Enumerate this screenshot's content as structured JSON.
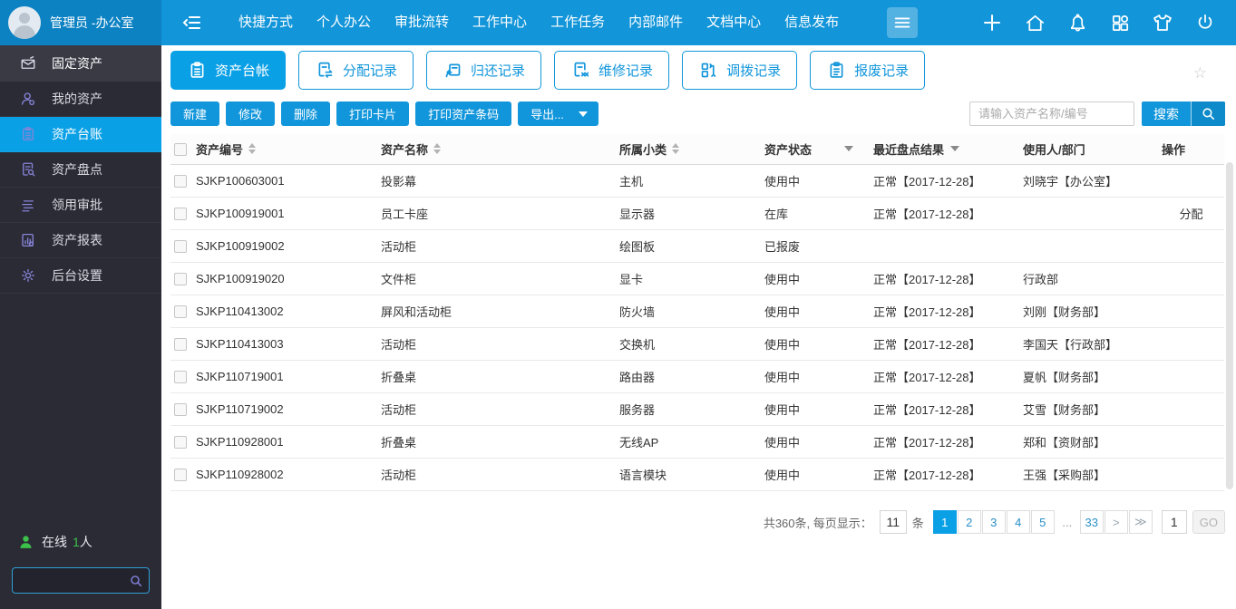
{
  "header": {
    "user_name": "管理员 -办公室",
    "nav": [
      "快捷方式",
      "个人办公",
      "审批流转",
      "工作中心",
      "工作任务",
      "内部邮件",
      "文档中心",
      "信息发布"
    ]
  },
  "sidebar": {
    "section_label": "固定资产",
    "items": [
      {
        "label": "我的资产"
      },
      {
        "label": "资产台账"
      },
      {
        "label": "资产盘点"
      },
      {
        "label": "领用审批"
      },
      {
        "label": "资产报表"
      },
      {
        "label": "后台设置"
      }
    ],
    "online_label": "在线",
    "online_count": "1",
    "online_unit": "人"
  },
  "tabs": [
    {
      "label": "资产台帐"
    },
    {
      "label": "分配记录"
    },
    {
      "label": "归还记录"
    },
    {
      "label": "维修记录"
    },
    {
      "label": "调拨记录"
    },
    {
      "label": "报废记录"
    }
  ],
  "toolbar": {
    "new": "新建",
    "edit": "修改",
    "delete": "删除",
    "print_card": "打印卡片",
    "print_barcode": "打印资产条码",
    "export": "导出...",
    "search_placeholder": "请输入资产名称/编号",
    "search_label": "搜索"
  },
  "table": {
    "columns": {
      "id": "资产编号",
      "name": "资产名称",
      "category": "所属小类",
      "status": "资产状态",
      "result": "最近盘点结果",
      "user": "使用人/部门",
      "op": "操作"
    },
    "rows": [
      {
        "id": "SJKP100603001",
        "name": "投影幕",
        "category": "主机",
        "status": "使用中",
        "result": "正常【2017-12-28】",
        "user": "刘晓宇【办公室】",
        "op": ""
      },
      {
        "id": "SJKP100919001",
        "name": "员工卡座",
        "category": "显示器",
        "status": "在库",
        "result": "正常【2017-12-28】",
        "user": "",
        "op": "分配"
      },
      {
        "id": "SJKP100919002",
        "name": "活动柜",
        "category": "绘图板",
        "status": "已报废",
        "result": "",
        "user": "",
        "op": ""
      },
      {
        "id": "SJKP100919020",
        "name": "文件柜",
        "category": "显卡",
        "status": "使用中",
        "result": "正常【2017-12-28】",
        "user": "行政部",
        "op": ""
      },
      {
        "id": "SJKP110413002",
        "name": "屏风和活动柜",
        "category": "防火墙",
        "status": "使用中",
        "result": "正常【2017-12-28】",
        "user": "刘刚【财务部】",
        "op": ""
      },
      {
        "id": "SJKP110413003",
        "name": "活动柜",
        "category": "交换机",
        "status": "使用中",
        "result": "正常【2017-12-28】",
        "user": "李国天【行政部】",
        "op": ""
      },
      {
        "id": "SJKP110719001",
        "name": "折叠桌",
        "category": "路由器",
        "status": "使用中",
        "result": "正常【2017-12-28】",
        "user": "夏帆【财务部】",
        "op": ""
      },
      {
        "id": "SJKP110719002",
        "name": "活动柜",
        "category": "服务器",
        "status": "使用中",
        "result": "正常【2017-12-28】",
        "user": "艾雪【财务部】",
        "op": ""
      },
      {
        "id": "SJKP110928001",
        "name": "折叠桌",
        "category": "无线AP",
        "status": "使用中",
        "result": "正常【2017-12-28】",
        "user": "郑和【资财部】",
        "op": ""
      },
      {
        "id": "SJKP110928002",
        "name": "活动柜",
        "category": "语言模块",
        "status": "使用中",
        "result": "正常【2017-12-28】",
        "user": "王强【采购部】",
        "op": ""
      }
    ]
  },
  "pagination": {
    "summary": "共360条, 每页显示：",
    "page_size": "11",
    "unit": "条",
    "pages": [
      "1",
      "2",
      "3",
      "4",
      "5",
      "...",
      "33",
      ">",
      "≫"
    ],
    "jump": "1",
    "go": "GO"
  },
  "icons": {
    "star": "☆"
  },
  "colors": {
    "topbar_blue": "#1295d9",
    "accent_blue": "#1296db",
    "active_blue": "#0aa0e6",
    "sidebar_bg": "#2b2b36",
    "icon_purple": "#8684d8",
    "online_green": "#3cc24a"
  }
}
